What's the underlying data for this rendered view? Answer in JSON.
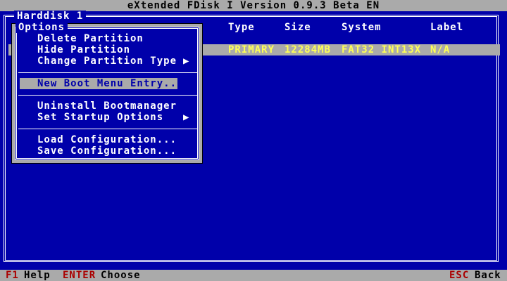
{
  "title": "eXtended FDisk I Version 0.9.3 Beta EN",
  "disk": {
    "title": "Harddisk 1"
  },
  "table": {
    "columns": [
      "Type",
      "Size",
      "System",
      "Label"
    ],
    "rows": [
      {
        "type": "PRIMARY",
        "size": "12284MB",
        "system": "FAT32 INT13X",
        "label": "N/A"
      }
    ]
  },
  "options_menu": {
    "title": "Options",
    "items": [
      {
        "label": "Delete Partition",
        "submenu": false
      },
      {
        "label": "Hide Partition",
        "submenu": false
      },
      {
        "label": "Change Partition Type",
        "submenu": true,
        "arrow": "▶"
      },
      {
        "label": "New Boot Menu Entry...",
        "selected": true
      },
      {
        "label": "Uninstall Bootmanager",
        "submenu": false
      },
      {
        "label": "Set Startup Options",
        "submenu": true,
        "arrow": "▶"
      },
      {
        "label": "Load Configuration...",
        "submenu": false
      },
      {
        "label": "Save Configuration...",
        "submenu": false
      }
    ]
  },
  "status": {
    "f1_key": "F1",
    "f1_label": "Help",
    "enter_key": "ENTER",
    "enter_label": "Choose",
    "esc_key": "ESC",
    "esc_label": "Back"
  },
  "colors": {
    "background": "#0000aa",
    "bar": "#aaaaaa",
    "highlight_text": "#ffff55",
    "key_text": "#aa0000"
  }
}
